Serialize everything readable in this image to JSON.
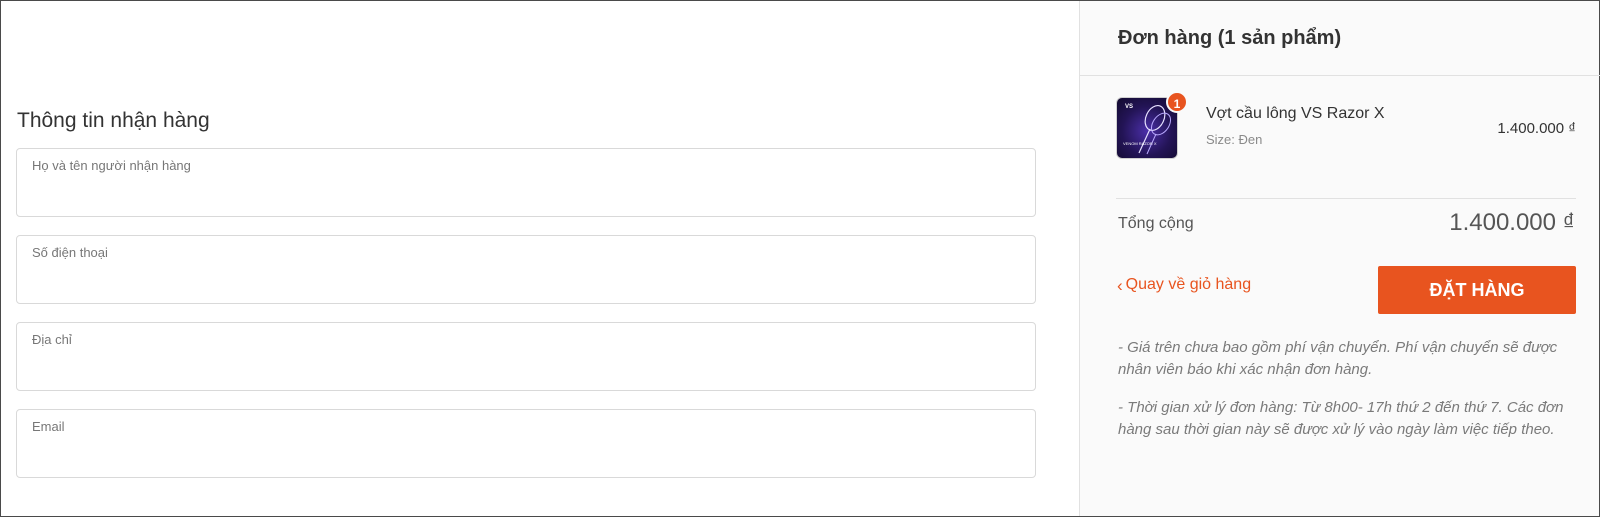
{
  "checkout_form": {
    "section_title": "Thông tin nhận hàng",
    "fields": [
      {
        "label": "Họ và tên người nhận hàng",
        "value": ""
      },
      {
        "label": "Số điện thoại",
        "value": ""
      },
      {
        "label": "Địa chỉ",
        "value": ""
      },
      {
        "label": "Email",
        "value": ""
      }
    ]
  },
  "order_summary": {
    "title": "Đơn hàng (1 sản phẩm)",
    "items": [
      {
        "name": "Vợt cầu lông VS Razor X",
        "variant": "Size: Đen",
        "price": "1.400.000 ₫",
        "quantity": "1",
        "thumbnail_text": "VS",
        "thumbnail_caption": "VENOM RAZOR X"
      }
    ],
    "total_label": "Tổng cộng",
    "total_value": "1.400.000 ₫",
    "back_link": "Quay về giỏ hàng",
    "order_button": "ĐẶT HÀNG",
    "notes": [
      "- Giá trên chưa bao gồm phí vận chuyển. Phí vận chuyển sẽ được nhân viên báo khi xác nhận đơn hàng.",
      "- Thời gian xử lý đơn hàng: Từ 8h00- 17h thứ 2 đến thứ 7. Các đơn hàng sau thời gian này sẽ được xử lý vào ngày làm việc tiếp theo."
    ]
  },
  "colors": {
    "accent": "#e8541f",
    "panel_bg": "#fafafa",
    "border": "#d9d9d9"
  }
}
